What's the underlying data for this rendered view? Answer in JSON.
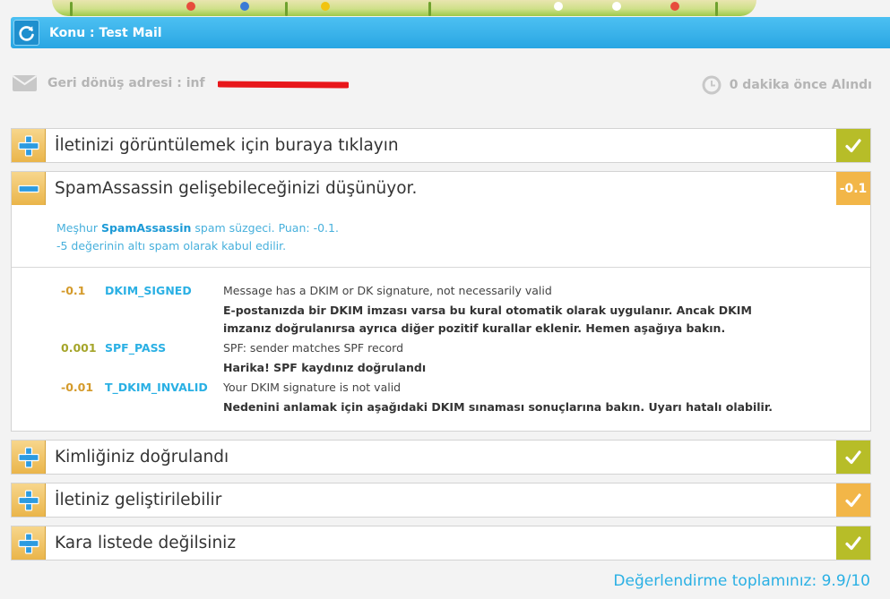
{
  "header": {
    "subject": "Konu : Test Mail"
  },
  "meta": {
    "return_address_label": "Geri dönüş adresi : inf",
    "received_label": "0 dakika önce Alındı"
  },
  "sections": [
    {
      "title": "İletinizi görüntülemek için buraya tıklayın",
      "status": "✓",
      "status_color": "#b7bd28",
      "expanded": false
    },
    {
      "title": "SpamAssassin gelişebileceğinizi düşünüyor.",
      "status": "-0.1",
      "status_color": "#f2b648",
      "expanded": true
    },
    {
      "title": "Kimliğiniz doğrulandı",
      "status": "✓",
      "status_color": "#b7bd28",
      "expanded": false
    },
    {
      "title": "İletiniz geliştirilebilir",
      "status": "✓",
      "status_color": "#f2b648",
      "expanded": false
    },
    {
      "title": "Kara listede değilsiniz",
      "status": "✓",
      "status_color": "#b7bd28",
      "expanded": false
    }
  ],
  "spam_panel": {
    "intro_prefix": "Meşhur ",
    "intro_brand": "SpamAssassin",
    "intro_suffix": " spam süzgeci. Puan: -0.1.",
    "intro_line2": "-5 değerinin altı spam olarak kabul edilir.",
    "rules": [
      {
        "score": "-0.1",
        "name": "DKIM_SIGNED",
        "description": "Message has a DKIM or DK signature, not necessarily valid",
        "note": "E-postanızda bir DKIM imzası varsa bu kural otomatik olarak uygulanır. Ancak DKIM imzanız doğrulanırsa ayrıca diğer pozitif kurallar eklenir. Hemen aşağıya bakın."
      },
      {
        "score": "0.001",
        "name": "SPF_PASS",
        "description": "SPF: sender matches SPF record",
        "note": "Harika! SPF kaydınız doğrulandı"
      },
      {
        "score": "-0.01",
        "name": "T_DKIM_INVALID",
        "description": "Your DKIM signature is not valid",
        "note": "Nedenini anlamak için aşağıdaki DKIM sınaması sonuçlarına bakın. Uyarı hatalı olabilir."
      }
    ]
  },
  "footer": {
    "total": "Değerlendirme toplamınız: 9.9/10"
  },
  "colors": {
    "accent_blue": "#2aa6e3",
    "olive": "#b7bd28",
    "orange": "#f2b648"
  }
}
